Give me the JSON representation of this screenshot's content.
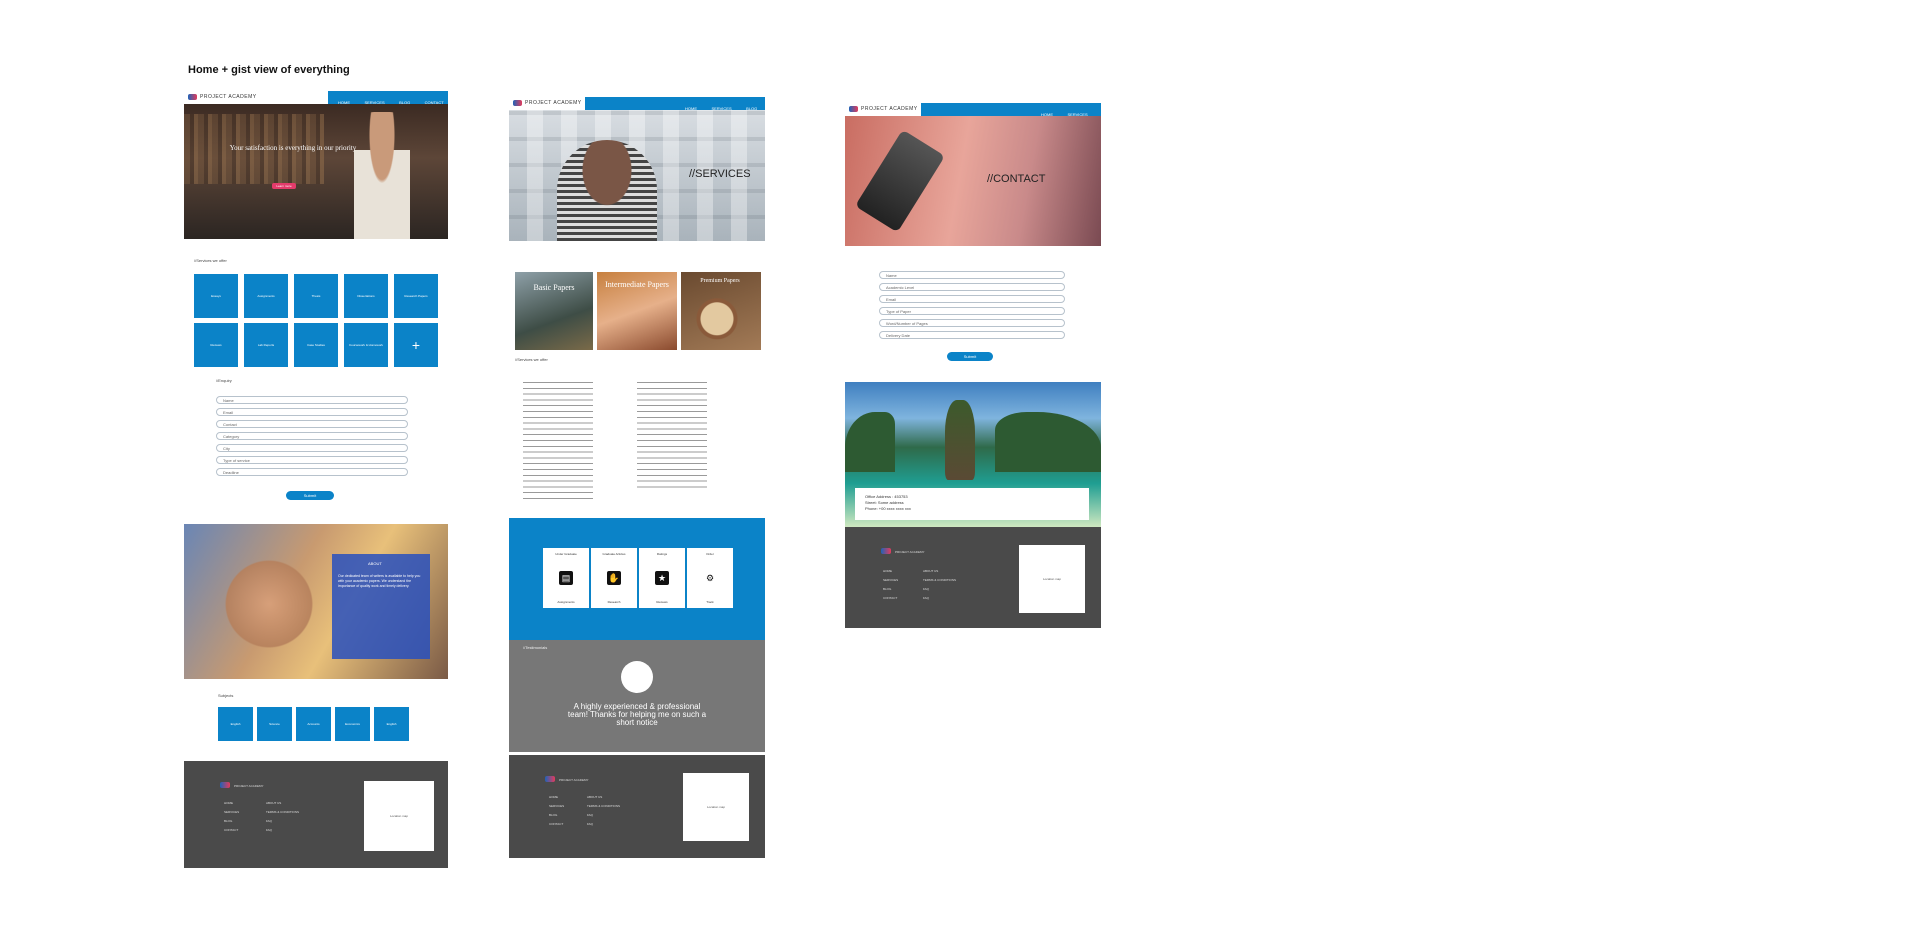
{
  "title": "Home + gist view of everything",
  "brand": "PROJECT ACADEMY",
  "nav": {
    "home": "HOME",
    "services": "SERVICES",
    "blog": "BLOG",
    "contact": "CONTACT"
  },
  "home": {
    "hero_title": "Your satisfaction is everything in our priority",
    "hero_button": "Learn more",
    "services_heading": "//Services we offer",
    "tiles": [
      "Essays",
      "Assignments",
      "Thesis",
      "Dissertations",
      "Research Papers",
      "Reviews",
      "Lab Reports",
      "Case Studies",
      "Coursework & Homework",
      "+"
    ],
    "enquiry_heading": "//Enquiry",
    "fields": [
      "Name",
      "Email",
      "Contact",
      "Category",
      "City",
      "Type of service",
      "Deadline"
    ],
    "submit": "Submit",
    "about_heading": "ABOUT",
    "about_text": "Our dedicated team of writers is available to help you with your academic papers. We understand the importance of quality work and timely delivery.",
    "subjects_heading": "Subjects",
    "subjects": [
      "English",
      "Science",
      "Accounts",
      "Economics",
      "English"
    ],
    "footer_box": "Location map"
  },
  "services": {
    "hero": "//SERVICES",
    "levels": [
      "Basic Papers",
      "Intermediate Papers",
      "Premium Papers"
    ],
    "list_heading": "//Services we offer",
    "cards": [
      {
        "top": "Under Graduate",
        "bottom": "Assignments",
        "icon": "book-icon"
      },
      {
        "top": "Graduate Articles",
        "bottom": "Research",
        "icon": "hands-icon"
      },
      {
        "top": "Ratings",
        "bottom": "Reviews",
        "icon": "star-icon"
      },
      {
        "top": "Order",
        "bottom": "Track",
        "icon": "gear-icon"
      }
    ],
    "testimonial_heading": "//Testimonials",
    "testimonial_text": "A highly experienced & professional team! Thanks for helping me on such a short notice"
  },
  "contact": {
    "hero": "//CONTACT",
    "fields": [
      "Name",
      "Academic Level",
      "Email",
      "Type of Paper",
      "Word/Number of Pages",
      "Delivery Date"
    ],
    "submit": "Submit",
    "address_line1": "Office Address : 453753",
    "address_line2": "Street: Some address",
    "address_line3": "Phone: +00 xxxx xxxx xxx",
    "footer_box": "Location map"
  },
  "footer_links": {
    "col1": [
      "HOME",
      "SERVICES",
      "BLOG",
      "CONTACT"
    ],
    "col2": [
      "ABOUT US",
      "TERMS & CONDITIONS",
      "FAQ",
      "FAQ"
    ]
  }
}
